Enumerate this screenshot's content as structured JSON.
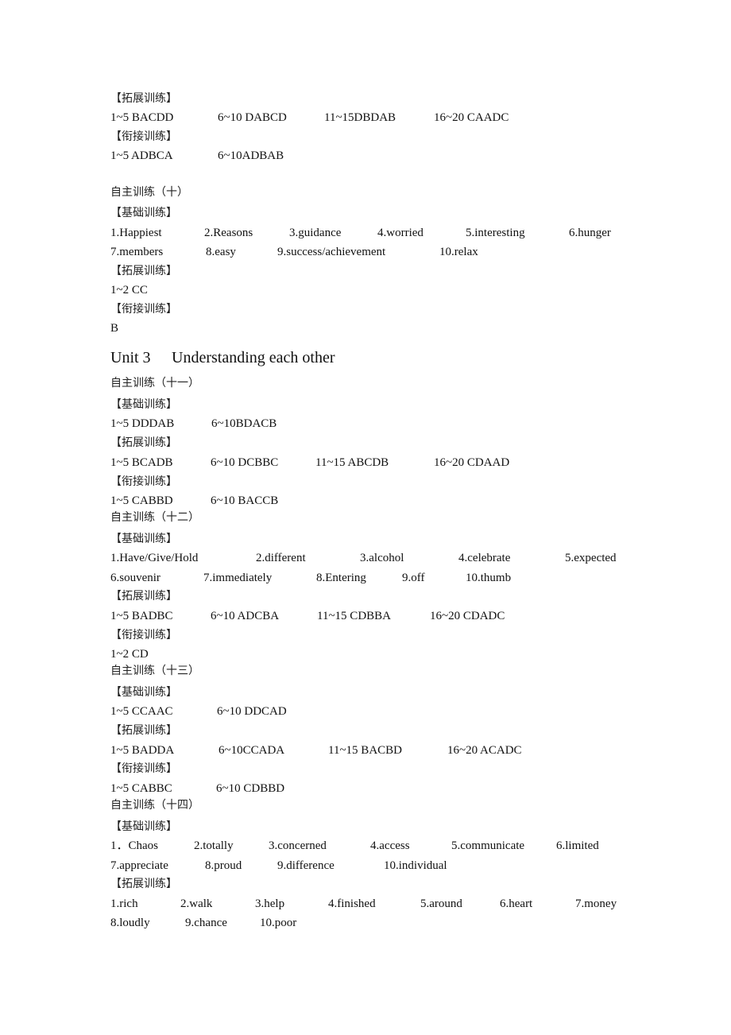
{
  "document": {
    "block_top": {
      "extended_label": "【拓展训练】",
      "extended_answers": [
        "1~5 BACDD",
        "6~10 DABCD",
        "11~15DBDAB",
        "16~20 CAADC"
      ],
      "bridge_label": "【衔接训练】",
      "bridge_answers": [
        "1~5 ADBCA",
        "6~10ADBAB"
      ]
    },
    "exercise_10": {
      "title": "自主训练（十）",
      "basic_label": "【基础训练】",
      "basic_row1": [
        "1.Happiest",
        "2.Reasons",
        "3.guidance",
        "4.worried",
        "5.interesting",
        "6.hunger"
      ],
      "basic_row2": [
        "7.members",
        "8.easy",
        "9.success/achievement",
        "10.relax"
      ],
      "extended_label": "【拓展训练】",
      "extended_answers": [
        "1~2 CC"
      ],
      "bridge_label": "【衔接训练】",
      "bridge_answers": [
        "B"
      ]
    },
    "unit_heading": {
      "unit": "Unit 3",
      "title": "Understanding each other"
    },
    "exercise_11": {
      "title": "自主训练（十一）",
      "basic_label": "【基础训练】",
      "basic_answers": [
        "1~5 DDDAB",
        "6~10BDACB"
      ],
      "extended_label": "【拓展训练】",
      "extended_answers": [
        "1~5 BCADB",
        "6~10 DCBBC",
        "11~15 ABCDB",
        "16~20 CDAAD"
      ],
      "bridge_label": "【衔接训练】",
      "bridge_answers": [
        "1~5 CABBD",
        "6~10 BACCB"
      ]
    },
    "exercise_12": {
      "title": "自主训练（十二）",
      "basic_label": "【基础训练】",
      "basic_row1": [
        "1.Have/Give/Hold",
        "2.different",
        "3.alcohol",
        "4.celebrate",
        "5.expected"
      ],
      "basic_row2": [
        "6.souvenir",
        "7.immediately",
        "8.Entering",
        "9.off",
        "10.thumb"
      ],
      "extended_label": "【拓展训练】",
      "extended_answers": [
        "1~5 BADBC",
        "6~10 ADCBA",
        "11~15 CDBBA",
        "16~20 CDADC"
      ],
      "bridge_label": "【衔接训练】",
      "bridge_answers": [
        "1~2 CD"
      ]
    },
    "exercise_13": {
      "title": "自主训练（十三）",
      "basic_label": "【基础训练】",
      "basic_answers": [
        "1~5 CCAAC",
        "6~10 DDCAD"
      ],
      "extended_label": "【拓展训练】",
      "extended_answers": [
        "1~5 BADDA",
        "6~10CCADA",
        "11~15 BACBD",
        "16~20 ACADC"
      ],
      "bridge_label": "【衔接训练】",
      "bridge_answers": [
        "1~5 CABBC",
        "6~10 CDBBD"
      ]
    },
    "exercise_14": {
      "title": "自主训练（十四）",
      "basic_label": "【基础训练】",
      "basic_row1": [
        "1．Chaos",
        "2.totally",
        "3.concerned",
        "4.access",
        "5.communicate",
        "6.limited"
      ],
      "basic_row2": [
        "7.appreciate",
        "8.proud",
        "9.difference",
        "10.individual"
      ],
      "extended_label": "【拓展训练】",
      "extended_row1": [
        "1.rich",
        "2.walk",
        "3.help",
        "4.finished",
        "5.around",
        "6.heart",
        "7.money"
      ],
      "extended_row2": [
        "8.loudly",
        "9.chance",
        "10.poor"
      ]
    }
  }
}
